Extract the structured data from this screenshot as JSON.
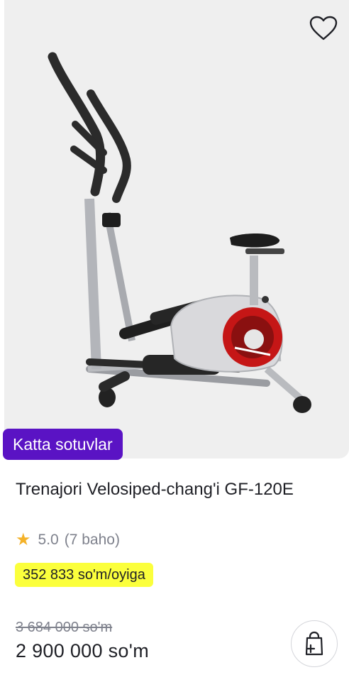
{
  "product": {
    "badge": "Katta sotuvlar",
    "title": "Trenajori Velosiped-chang'i GF-120E",
    "rating": {
      "value": "5.0",
      "count_text": "(7 baho)"
    },
    "installment": "352 833 so'm/oyiga",
    "old_price": "3 684 000 so'm",
    "price": "2 900 000 so'm"
  },
  "icons": {
    "favorite": "heart-outline-icon",
    "star": "star-icon",
    "cart": "shopping-bag-plus-icon"
  },
  "colors": {
    "badge_bg": "#5a13c4",
    "installment_bg": "#fbff3c",
    "star": "#f4b229",
    "muted_text": "#7e818c"
  }
}
